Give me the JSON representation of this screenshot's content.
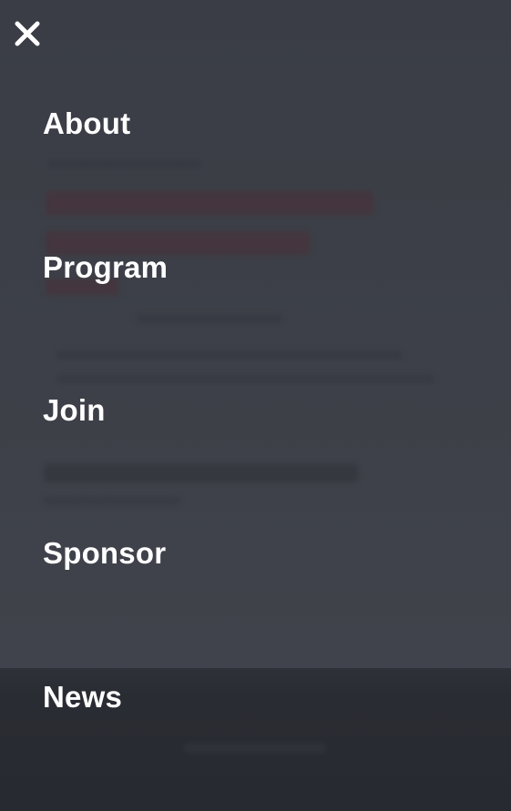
{
  "nav": {
    "close_icon": "close-icon",
    "items": [
      {
        "label": "About"
      },
      {
        "label": "Program"
      },
      {
        "label": "Join"
      },
      {
        "label": "Sponsor"
      },
      {
        "label": "News"
      }
    ]
  },
  "colors": {
    "overlay_bg": "#3b3e46",
    "footer_bg": "#282a31",
    "nav_text": "#ffffff"
  }
}
